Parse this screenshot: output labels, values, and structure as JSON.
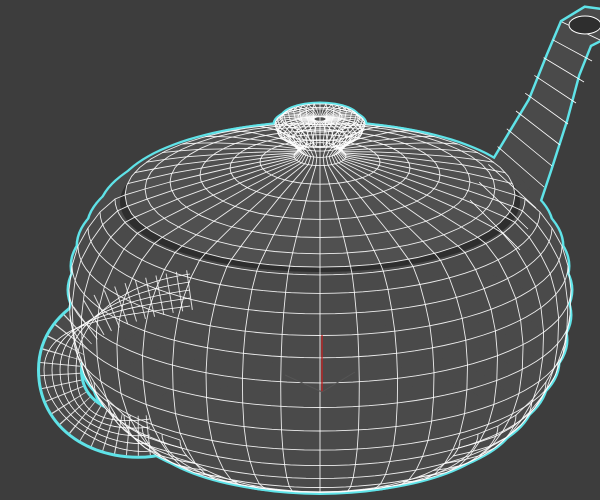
{
  "viewport": {
    "background": "#3d3d3d",
    "selection_outline": "#5fe3e8",
    "wire_color": "#ffffff",
    "surface_color": "#4a4a4a",
    "axis_color": "#d02020",
    "icons": [
      "teapot-wireframe-model",
      "transform-gizmo-icon"
    ]
  }
}
